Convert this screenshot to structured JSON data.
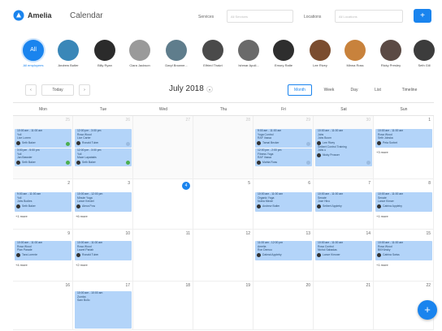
{
  "app": {
    "name": "Amelia",
    "page_title": "Calendar"
  },
  "filters": {
    "services_label": "Services",
    "services_placeholder": "All Services",
    "locations_label": "Locations",
    "locations_placeholder": "All Locations",
    "add_icon": "plus-icon"
  },
  "employees": [
    {
      "name": "All employees",
      "selected": true,
      "initials": "All"
    },
    {
      "name": "Andrew Butler"
    },
    {
      "name": "Billy Ryan"
    },
    {
      "name": "Clara Jackson"
    },
    {
      "name": "Daryl Browne..."
    },
    {
      "name": "Elfried Thakri"
    },
    {
      "name": "Ishmar Apoll..."
    },
    {
      "name": "Emory Ralte"
    },
    {
      "name": "Lee Rivey"
    },
    {
      "name": "Minna Ross"
    },
    {
      "name": "Ricky Presley"
    },
    {
      "name": "Seth Gill"
    }
  ],
  "toolbar": {
    "prev": "‹",
    "today": "Today",
    "next": "›",
    "month": "July 2018",
    "views": [
      "Month",
      "Week",
      "Day",
      "List",
      "Timeline"
    ],
    "active_view": "Month"
  },
  "weekdays": [
    "Mon",
    "Tue",
    "Wed",
    "Thu",
    "Fri",
    "Sat",
    "Sun"
  ],
  "weeks": [
    {
      "days": [
        "25",
        "26",
        "27",
        "28",
        "29",
        "30",
        "1"
      ]
    },
    {
      "days": [
        "2",
        "3",
        "4",
        "5",
        "6",
        "7",
        "8"
      ]
    },
    {
      "days": [
        "9",
        "10",
        "11",
        "12",
        "13",
        "14",
        "15"
      ]
    },
    {
      "days": [
        "16",
        "17",
        "18",
        "19",
        "20",
        "21",
        "22"
      ]
    }
  ],
  "events": {
    "w0_mon_a": {
      "time": "10:00 am - 11:00 am",
      "l1": "Yoli",
      "l2": "Lice Lorem",
      "emp": "Seth Baker",
      "status": "approved"
    },
    "w0_mon_b": {
      "time": "3:00 pm - 5:00 pm",
      "l1": "Yoli",
      "l2": "Jan Bawster",
      "emp": "Seth Baker",
      "status": "approved"
    },
    "w0_tue_a": {
      "time": "12:00 pm - 3:00 pm",
      "l1": "Rosa Wood",
      "l2": "Lice Carter",
      "emp": "Ronald Tuber",
      "status": "pending"
    },
    "w0_tue_b": {
      "time": "12:00 pm - 3:00 pm",
      "l1": "Yoli",
      "l2": "Mace Lapatakis",
      "emp": "Seth Baker",
      "status": "approved"
    },
    "w0_fri_a": {
      "time": "9:00 am - 11:00 am",
      "l1": "Yoga Control",
      "l2": "RAF Vassa",
      "emp": "Tamal Becker",
      "status": "pending"
    },
    "w0_fri_b": {
      "time": "12:00 pm - 2:00 pm",
      "l1": "Fitness Yoga",
      "l2": "RAF Vassa",
      "emp": "Mahta Ross",
      "status": "pending"
    },
    "w0_sat": {
      "time": "10:00 am - 11:00 am",
      "l1": "Jobs",
      "l2": "Jobs Boom",
      "emp": "Lee Rivey",
      "extra": "Seibert Control Training",
      "extra2": "Jobs u",
      "emp2": "Nicky Prosser",
      "status": "pending"
    },
    "w0_sun": {
      "time": "10:00 am - 11:00 am",
      "l1": "Rosa Wood",
      "l2": "Seth Jobska",
      "emp": "Peta Sorbet",
      "status": "pending"
    },
    "w0_sun_more": "+3 more",
    "w1_mon": {
      "time": "9:00 am - 11:00 am",
      "l1": "Yoli",
      "l2": "Jobs Bodies",
      "emp": "Seth Baker",
      "status": "pending"
    },
    "w1_mon_more": "+1 more",
    "w1_tue": {
      "time": "10:00 am - 12:00 pm",
      "l1": "Minute Yoga",
      "l2": "Lance Kendel",
      "emp": "Alexa Pow",
      "status": "pending"
    },
    "w1_tue_more": "+6 more",
    "w1_fri": {
      "time": "10:00 am - 11:00 am",
      "l1": "Organic Yoga",
      "l2": "Nubia Minde",
      "emp": "Andrew Butler",
      "status": "pending"
    },
    "w1_sat": {
      "time": "10:00 am - 11:00 am",
      "l1": "Senate",
      "l2": "Jose Hino",
      "emp": "Seibert Appleby",
      "status": "pending"
    },
    "w1_sun": {
      "time": "10:00 am - 11:00 am",
      "l1": "Senate",
      "l2": "Lance Kinser",
      "emp": "Catrina Appleby",
      "status": "pending"
    },
    "w1_sun_more": "+1 more",
    "w2_mon": {
      "time": "10:00 am - 11:00 am",
      "l1": "Rosa Wood",
      "l2": "Plan Parade",
      "emp": "Tara Lorente",
      "status": "pending"
    },
    "w2_mon_more": "+4 more",
    "w2_tue": {
      "time": "10:00 am - 11:00 am",
      "l1": "Rosa Wood",
      "l2": "Laurel Pariah",
      "emp": "Ronald Tuber",
      "status": "pending"
    },
    "w2_tue_more": "+2 more",
    "w2_fri": {
      "time": "11:00 am - 12:00 pm",
      "l1": "Amelia",
      "l2": "Ron Demco",
      "emp": "Dalmal Appleby",
      "status": "pending"
    },
    "w2_sat": {
      "time": "10:00 am - 11:00 am",
      "l1": "Rosa Control",
      "l2": "Nichol Sabadas",
      "emp": "Lance Kinsner",
      "status": "pending"
    },
    "w2_sun": {
      "time": "10:00 am - 11:00 am",
      "l1": "Rosa Wood",
      "l2": "Bill Kinsky",
      "emp": "Catrina Swiss",
      "status": "pending"
    },
    "w2_sun_more": "+1 more",
    "w3_tue": {
      "time": "10:00 am - 10:00 am",
      "l1": "Zumba",
      "l2": "Sam Bollo"
    }
  },
  "colors": {
    "accent": "#1a84ee",
    "event_bg": "#b3d4f9",
    "approved": "#4caf50"
  },
  "fab_icon": "plus-icon",
  "fab_label": "+"
}
